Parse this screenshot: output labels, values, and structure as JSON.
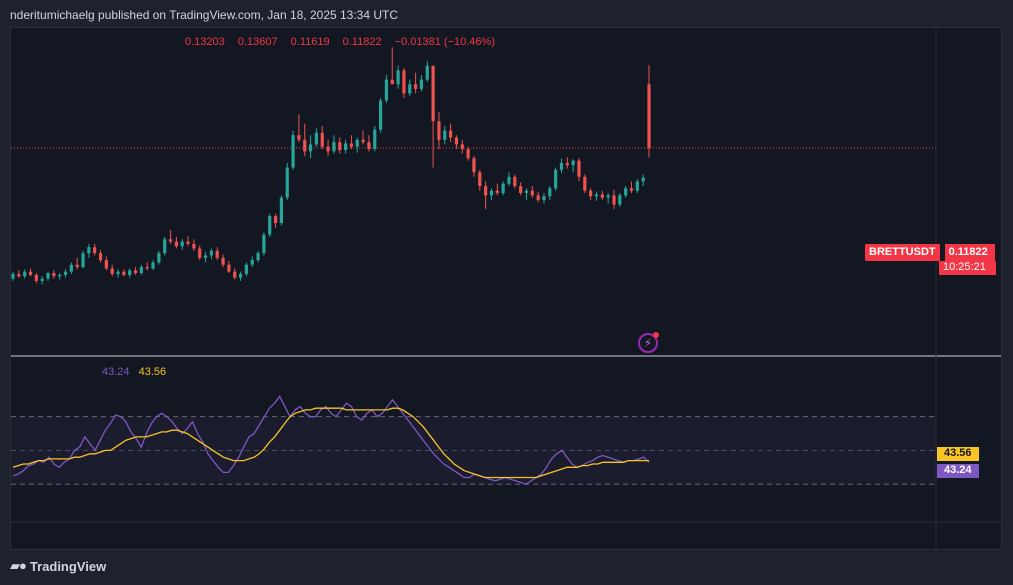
{
  "header": {
    "published": "nderitumichaelg published on TradingView.com, Jan 18, 2025 13:34 UTC"
  },
  "ohlc": {
    "open": "0.13203",
    "high": "0.13607",
    "low": "0.11619",
    "close": "0.11822",
    "change": "−0.01381 (−10.46%)"
  },
  "price_tag": {
    "symbol": "BRETTUSDT",
    "price": "0.11822",
    "countdown": "10:25:21"
  },
  "rsi_legend": {
    "rsi": "43.24",
    "ma": "43.56"
  },
  "rsi_tags": {
    "ma": "43.56",
    "rsi": "43.24"
  },
  "footer": {
    "brand": "TradingView"
  },
  "icons": {
    "logo": "tradingview-logo-icon",
    "alert": "lightning-alert-icon"
  },
  "colors": {
    "up": "#26a69a",
    "down": "#ef5350",
    "rsi": "#7e57c2",
    "rsi_ma": "#f7c325",
    "last_price": "#f23645"
  },
  "chart_data": [
    {
      "type": "candlestick",
      "symbol": "BRETTUSDT",
      "ylim": [
        0.075,
        0.142
      ],
      "last_price": 0.11822,
      "candles": [
        [
          0.09,
          0.0915,
          0.0895,
          0.091
        ],
        [
          0.091,
          0.0918,
          0.0902,
          0.0905
        ],
        [
          0.0905,
          0.092,
          0.09,
          0.0915
        ],
        [
          0.0915,
          0.0922,
          0.0905,
          0.0908
        ],
        [
          0.0908,
          0.0912,
          0.089,
          0.0895
        ],
        [
          0.0895,
          0.0905,
          0.0888,
          0.09
        ],
        [
          0.09,
          0.0915,
          0.0895,
          0.0912
        ],
        [
          0.0912,
          0.0918,
          0.09,
          0.0905
        ],
        [
          0.0905,
          0.0912,
          0.0898,
          0.0908
        ],
        [
          0.0908,
          0.092,
          0.0902,
          0.0915
        ],
        [
          0.0915,
          0.0935,
          0.091,
          0.093
        ],
        [
          0.093,
          0.0945,
          0.092,
          0.0925
        ],
        [
          0.0925,
          0.096,
          0.0922,
          0.0955
        ],
        [
          0.0955,
          0.0975,
          0.0945,
          0.0968
        ],
        [
          0.0968,
          0.0975,
          0.095,
          0.0955
        ],
        [
          0.0955,
          0.0962,
          0.0935,
          0.094
        ],
        [
          0.094,
          0.0948,
          0.0918,
          0.0922
        ],
        [
          0.0922,
          0.093,
          0.0905,
          0.091
        ],
        [
          0.091,
          0.092,
          0.0902,
          0.0915
        ],
        [
          0.0915,
          0.092,
          0.0905,
          0.0908
        ],
        [
          0.0908,
          0.0922,
          0.0902,
          0.0918
        ],
        [
          0.0918,
          0.0925,
          0.0908,
          0.0912
        ],
        [
          0.0912,
          0.093,
          0.0908,
          0.0925
        ],
        [
          0.0925,
          0.0935,
          0.0918,
          0.0922
        ],
        [
          0.0922,
          0.094,
          0.0918,
          0.0935
        ],
        [
          0.0935,
          0.096,
          0.093,
          0.0955
        ],
        [
          0.0955,
          0.099,
          0.095,
          0.0985
        ],
        [
          0.0985,
          0.1005,
          0.0975,
          0.098
        ],
        [
          0.098,
          0.099,
          0.0965,
          0.097
        ],
        [
          0.097,
          0.0985,
          0.0962,
          0.098
        ],
        [
          0.098,
          0.0992,
          0.097,
          0.0975
        ],
        [
          0.0975,
          0.0985,
          0.096,
          0.0965
        ],
        [
          0.0965,
          0.0972,
          0.094,
          0.0945
        ],
        [
          0.0945,
          0.0958,
          0.0935,
          0.095
        ],
        [
          0.095,
          0.0965,
          0.0942,
          0.096
        ],
        [
          0.096,
          0.0968,
          0.094,
          0.0945
        ],
        [
          0.0945,
          0.0952,
          0.0925,
          0.093
        ],
        [
          0.093,
          0.0938,
          0.0912,
          0.0915
        ],
        [
          0.0915,
          0.0922,
          0.0898,
          0.0902
        ],
        [
          0.0902,
          0.0915,
          0.0895,
          0.091
        ],
        [
          0.091,
          0.0935,
          0.0905,
          0.093
        ],
        [
          0.093,
          0.0948,
          0.0925,
          0.094
        ],
        [
          0.094,
          0.096,
          0.0935,
          0.0955
        ],
        [
          0.0955,
          0.1,
          0.095,
          0.0995
        ],
        [
          0.0995,
          0.104,
          0.099,
          0.1035
        ],
        [
          0.1035,
          0.104,
          0.101,
          0.102
        ],
        [
          0.102,
          0.108,
          0.1015,
          0.1075
        ],
        [
          0.1075,
          0.115,
          0.107,
          0.114
        ],
        [
          0.114,
          0.122,
          0.1135,
          0.121
        ],
        [
          0.121,
          0.1255,
          0.1195,
          0.12
        ],
        [
          0.12,
          0.1235,
          0.1165,
          0.1175
        ],
        [
          0.1175,
          0.121,
          0.116,
          0.119
        ],
        [
          0.119,
          0.1225,
          0.1185,
          0.1215
        ],
        [
          0.1215,
          0.123,
          0.118,
          0.1185
        ],
        [
          0.1185,
          0.12,
          0.1165,
          0.1175
        ],
        [
          0.1175,
          0.121,
          0.117,
          0.1195
        ],
        [
          0.1195,
          0.1205,
          0.117,
          0.1178
        ],
        [
          0.1178,
          0.12,
          0.117,
          0.1192
        ],
        [
          0.1192,
          0.121,
          0.118,
          0.1185
        ],
        [
          0.1185,
          0.1205,
          0.1172,
          0.12
        ],
        [
          0.12,
          0.122,
          0.119,
          0.1195
        ],
        [
          0.1195,
          0.121,
          0.1175,
          0.118
        ],
        [
          0.118,
          0.123,
          0.1175,
          0.1222
        ],
        [
          0.1222,
          0.129,
          0.1215,
          0.1285
        ],
        [
          0.1285,
          0.134,
          0.128,
          0.133
        ],
        [
          0.133,
          0.14,
          0.132,
          0.132
        ],
        [
          0.132,
          0.136,
          0.131,
          0.135
        ],
        [
          0.135,
          0.1355,
          0.129,
          0.13
        ],
        [
          0.13,
          0.133,
          0.1295,
          0.132
        ],
        [
          0.132,
          0.1345,
          0.13,
          0.131
        ],
        [
          0.131,
          0.134,
          0.1305,
          0.133
        ],
        [
          0.133,
          0.137,
          0.1325,
          0.136
        ],
        [
          0.136,
          0.136,
          0.114,
          0.124
        ],
        [
          0.124,
          0.126,
          0.118,
          0.12
        ],
        [
          0.12,
          0.123,
          0.119,
          0.122
        ],
        [
          0.122,
          0.1235,
          0.1195,
          0.1205
        ],
        [
          0.1205,
          0.121,
          0.118,
          0.119
        ],
        [
          0.119,
          0.12,
          0.117,
          0.118
        ],
        [
          0.118,
          0.1185,
          0.1155,
          0.116
        ],
        [
          0.116,
          0.1165,
          0.112,
          0.113
        ],
        [
          0.113,
          0.1135,
          0.109,
          0.11
        ],
        [
          0.11,
          0.111,
          0.105,
          0.108
        ],
        [
          0.108,
          0.1095,
          0.107,
          0.109
        ],
        [
          0.109,
          0.1105,
          0.108,
          0.1085
        ],
        [
          0.1085,
          0.111,
          0.108,
          0.1105
        ],
        [
          0.1105,
          0.113,
          0.11,
          0.112
        ],
        [
          0.112,
          0.1125,
          0.1095,
          0.11
        ],
        [
          0.11,
          0.1108,
          0.108,
          0.1085
        ],
        [
          0.1085,
          0.1095,
          0.107,
          0.109
        ],
        [
          0.109,
          0.11,
          0.1075,
          0.108
        ],
        [
          0.108,
          0.1088,
          0.1065,
          0.107
        ],
        [
          0.107,
          0.1085,
          0.1062,
          0.1078
        ],
        [
          0.1078,
          0.11,
          0.107,
          0.1095
        ],
        [
          0.1095,
          0.114,
          0.109,
          0.1135
        ],
        [
          0.1135,
          0.116,
          0.1128,
          0.115
        ],
        [
          0.115,
          0.1162,
          0.1138,
          0.1145
        ],
        [
          0.1145,
          0.1158,
          0.113,
          0.1155
        ],
        [
          0.1155,
          0.116,
          0.111,
          0.112
        ],
        [
          0.112,
          0.1125,
          0.1085,
          0.109
        ],
        [
          0.109,
          0.1095,
          0.107,
          0.1078
        ],
        [
          0.1078,
          0.1088,
          0.1068,
          0.1082
        ],
        [
          0.1082,
          0.109,
          0.107,
          0.1075
        ],
        [
          0.1075,
          0.1085,
          0.1062,
          0.108
        ],
        [
          0.108,
          0.1092,
          0.105,
          0.106
        ],
        [
          0.106,
          0.1085,
          0.1055,
          0.108
        ],
        [
          0.108,
          0.11,
          0.1075,
          0.1095
        ],
        [
          0.1095,
          0.111,
          0.1085,
          0.109
        ],
        [
          0.109,
          0.1115,
          0.1085,
          0.111
        ],
        [
          0.111,
          0.1125,
          0.11,
          0.1118
        ],
        [
          0.132,
          0.1361,
          0.1162,
          0.1182
        ]
      ]
    },
    {
      "type": "line",
      "ylim": [
        10,
        100
      ],
      "levels": [
        70,
        50,
        30
      ],
      "series": [
        {
          "values": [
            35,
            36,
            38,
            41,
            42,
            44,
            43,
            46,
            42,
            40,
            43,
            45,
            50,
            52,
            58,
            54,
            50,
            56,
            62,
            66,
            71,
            70,
            67,
            61,
            57,
            52,
            60,
            66,
            70,
            72,
            70,
            67,
            63,
            60,
            63,
            67,
            60,
            55,
            48,
            44,
            40,
            37,
            37,
            41,
            46,
            52,
            58,
            60,
            65,
            70,
            75,
            78,
            82,
            76,
            70,
            74,
            76,
            72,
            70,
            70,
            74,
            76,
            72,
            70,
            74,
            78,
            76,
            70,
            68,
            72,
            74,
            70,
            72,
            76,
            80,
            76,
            72,
            68,
            64,
            60,
            56,
            52,
            48,
            45,
            42,
            40,
            38,
            36,
            34,
            34,
            36,
            35,
            34,
            33,
            32,
            33,
            34,
            33,
            32,
            31,
            30,
            32,
            34,
            36,
            40,
            45,
            48,
            50,
            46,
            42,
            40,
            41,
            43,
            44,
            46,
            47,
            46,
            45,
            44,
            43,
            44,
            44,
            45,
            46,
            43
          ]
        },
        {
          "values": [
            40,
            41,
            42,
            42,
            43,
            44,
            44,
            45,
            45,
            45,
            45,
            45,
            46,
            46,
            47,
            48,
            48,
            49,
            50,
            50,
            52,
            54,
            56,
            57,
            58,
            58,
            58,
            59,
            60,
            61,
            61,
            62,
            62,
            61,
            60,
            58,
            56,
            54,
            52,
            50,
            48,
            46,
            45,
            44,
            44,
            44,
            45,
            46,
            48,
            51,
            55,
            58,
            62,
            66,
            70,
            72,
            73,
            74,
            74,
            75,
            75,
            75,
            75,
            75,
            75,
            74,
            74,
            74,
            74,
            74,
            74,
            74,
            74,
            74,
            75,
            75,
            74,
            72,
            70,
            67,
            64,
            60,
            56,
            52,
            48,
            45,
            42,
            40,
            38,
            37,
            36,
            35,
            34,
            34,
            34,
            34,
            34,
            34,
            34,
            34,
            34,
            34,
            34,
            35,
            36,
            37,
            38,
            39,
            40,
            40,
            40,
            41,
            41,
            42,
            42,
            43,
            43,
            43,
            43,
            43,
            44,
            44,
            44,
            44,
            44
          ]
        }
      ]
    }
  ]
}
